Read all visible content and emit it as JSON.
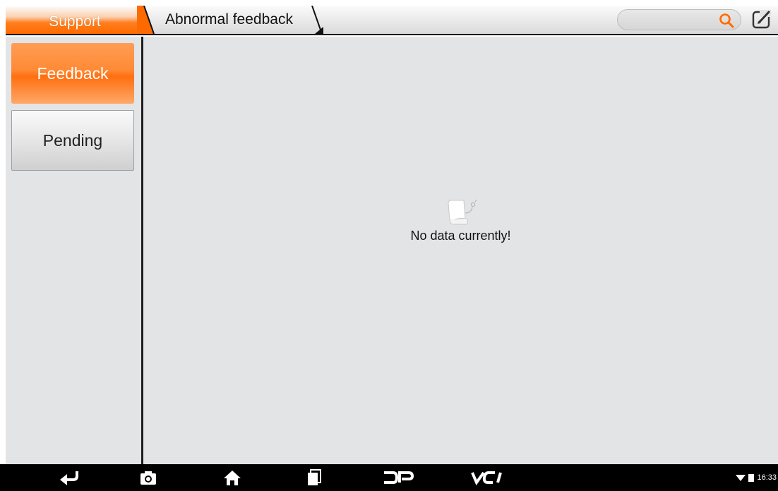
{
  "breadcrumb": {
    "home": "Support",
    "current": "Abnormal feedback"
  },
  "search": {
    "placeholder": ""
  },
  "sidebar": {
    "items": [
      {
        "label": "Feedback",
        "active": true
      },
      {
        "label": "Pending",
        "active": false
      }
    ]
  },
  "main": {
    "empty_message": "No data currently!",
    "empty_icon": "empty-document-icon"
  },
  "navbar": {
    "buttons": [
      "back-icon",
      "screenshot-icon",
      "home-icon",
      "recent-apps-icon",
      "dp-icon",
      "vci-icon"
    ],
    "dp_label": "DP",
    "vci_label": "VCI"
  },
  "status": {
    "time": "16:33",
    "icons": [
      "wifi-icon",
      "battery-icon"
    ]
  },
  "colors": {
    "accent": "#ff7a1a",
    "background": "#e3e4e6",
    "navbar": "#000000"
  }
}
